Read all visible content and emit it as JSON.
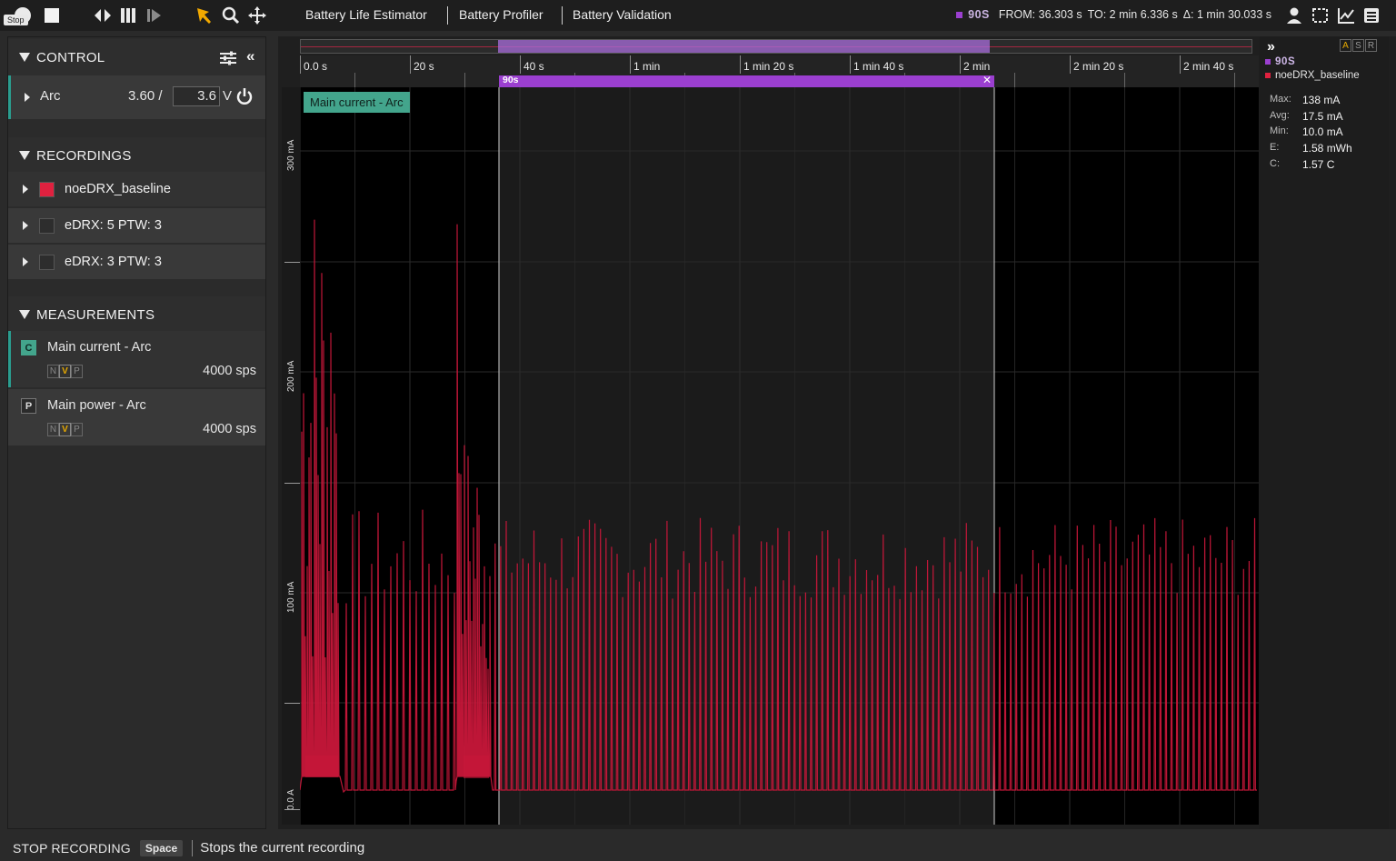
{
  "toolbar": {
    "tooltip": "Stop",
    "links": [
      "Battery Life Estimator",
      "Battery Profiler",
      "Battery Validation"
    ],
    "selection": {
      "tag": "90S",
      "from": "FROM: 36.303 s",
      "to": "TO: 2 min 6.336 s",
      "delta": "Δ: 1 min 30.033 s"
    }
  },
  "sidebar": {
    "control": {
      "title": "CONTROL",
      "device": "Arc",
      "voltage_read": "3.60 /",
      "voltage_set": "3.6",
      "unit": "V"
    },
    "recordings": {
      "title": "RECORDINGS",
      "items": [
        {
          "label": "noeDRX_baseline",
          "color": "#e0213f"
        },
        {
          "label": "eDRX: 5 PTW: 3",
          "color": "#2d2d2d"
        },
        {
          "label": "eDRX: 3 PTW: 3",
          "color": "#2d2d2d"
        }
      ]
    },
    "measurements": {
      "title": "MEASUREMENTS",
      "items": [
        {
          "badge": "C",
          "label": "Main current - Arc",
          "rate": "4000 sps",
          "nvp": [
            "N",
            "V",
            "P"
          ]
        },
        {
          "badge": "P",
          "label": "Main power - Arc",
          "rate": "4000 sps",
          "nvp": [
            "N",
            "V",
            "P"
          ]
        }
      ]
    }
  },
  "plot": {
    "trace_label": "Main current - Arc",
    "selection_label": "90s",
    "x_ticks": [
      "0.0 s",
      "20 s",
      "40 s",
      "1 min",
      "1 min 20 s",
      "1 min 40 s",
      "2 min",
      "2 min 20 s",
      "2 min 40 s"
    ],
    "y_ticks": [
      "0.0 A",
      "100 mA",
      "200 mA",
      "300 mA"
    ],
    "trace_color": "#c8173a",
    "selection_color": "#9b3fd0"
  },
  "stats": {
    "asr": [
      "A",
      "S",
      "R"
    ],
    "legend": [
      {
        "label": "90S",
        "color": "#9b3fd0"
      },
      {
        "label": "noeDRX_baseline",
        "color": "#e0213f"
      }
    ],
    "rows": [
      {
        "k": "Max:",
        "v": "138 mA"
      },
      {
        "k": "Avg:",
        "v": "17.5 mA"
      },
      {
        "k": "Min:",
        "v": "10.0 mA"
      },
      {
        "k": "E:",
        "v": "1.58 mWh"
      },
      {
        "k": "C:",
        "v": "1.57 C"
      }
    ]
  },
  "status": {
    "action": "STOP RECORDING",
    "key": "Space",
    "description": "Stops the current recording"
  }
}
